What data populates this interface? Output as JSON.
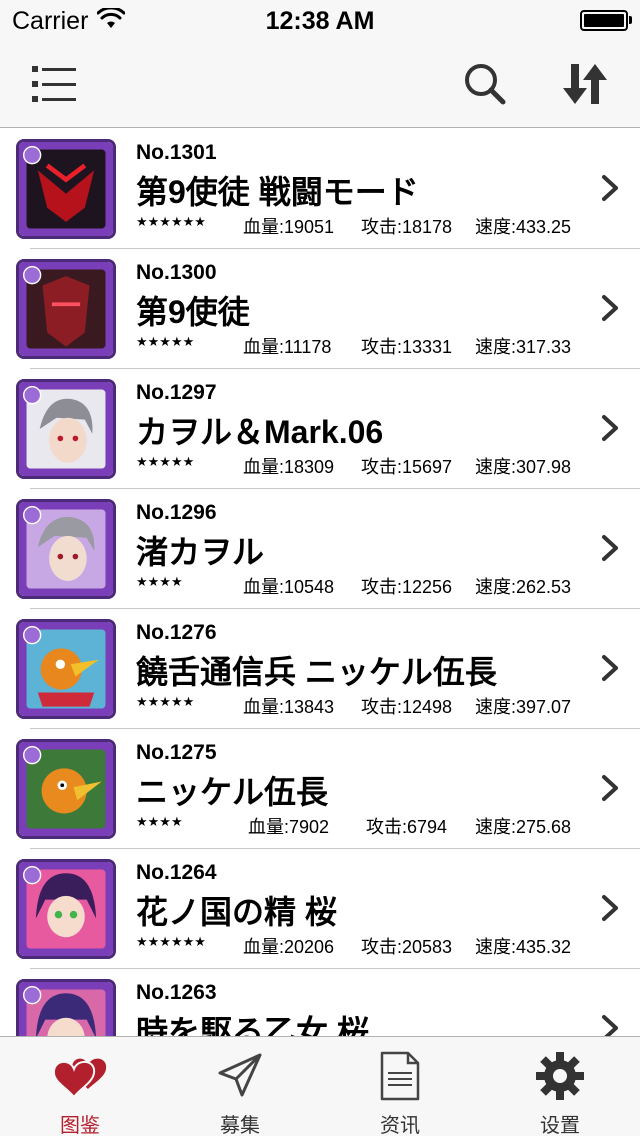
{
  "status_bar": {
    "carrier": "Carrier",
    "time": "12:38 AM"
  },
  "nav": {
    "menu_icon": "list-menu-icon",
    "search_icon": "search-icon",
    "sort_icon": "sort-icon"
  },
  "colors": {
    "accent": "#b3202d",
    "frame": "#4c2a78",
    "frame_light": "#9b6bd6"
  },
  "monsters": [
    {
      "no": "No.1301",
      "name": "第9使徒 戦闘モード",
      "stars": "★★★★★★",
      "hp": "血量:19051",
      "atk": "攻击:18178",
      "spd": "速度:433.25"
    },
    {
      "no": "No.1300",
      "name": "第9使徒",
      "stars": "★★★★★",
      "hp": "血量:11178",
      "atk": "攻击:13331",
      "spd": "速度:317.33"
    },
    {
      "no": "No.1297",
      "name": "カヲル＆Mark.06",
      "stars": "★★★★★",
      "hp": "血量:18309",
      "atk": "攻击:15697",
      "spd": "速度:307.98"
    },
    {
      "no": "No.1296",
      "name": "渚カヲル",
      "stars": "★★★★",
      "hp": "血量:10548",
      "atk": "攻击:12256",
      "spd": "速度:262.53"
    },
    {
      "no": "No.1276",
      "name": "饒舌通信兵 ニッケル伍長",
      "stars": "★★★★★",
      "hp": "血量:13843",
      "atk": "攻击:12498",
      "spd": "速度:397.07"
    },
    {
      "no": "No.1275",
      "name": "ニッケル伍長",
      "stars": "★★★★",
      "hp": "血量:7902",
      "atk": "攻击:6794",
      "spd": "速度:275.68"
    },
    {
      "no": "No.1264",
      "name": "花ノ国の精 桜",
      "stars": "★★★★★★",
      "hp": "血量:20206",
      "atk": "攻击:20583",
      "spd": "速度:435.32"
    },
    {
      "no": "No.1263",
      "name": "時を駆る乙女 桜",
      "stars": "",
      "hp": "",
      "atk": "",
      "spd": ""
    }
  ],
  "tabs": [
    {
      "label": "图鉴",
      "icon": "hearts-icon",
      "active": true
    },
    {
      "label": "募集",
      "icon": "paper-plane-icon",
      "active": false
    },
    {
      "label": "资讯",
      "icon": "document-icon",
      "active": false
    },
    {
      "label": "设置",
      "icon": "gear-icon",
      "active": false
    }
  ]
}
